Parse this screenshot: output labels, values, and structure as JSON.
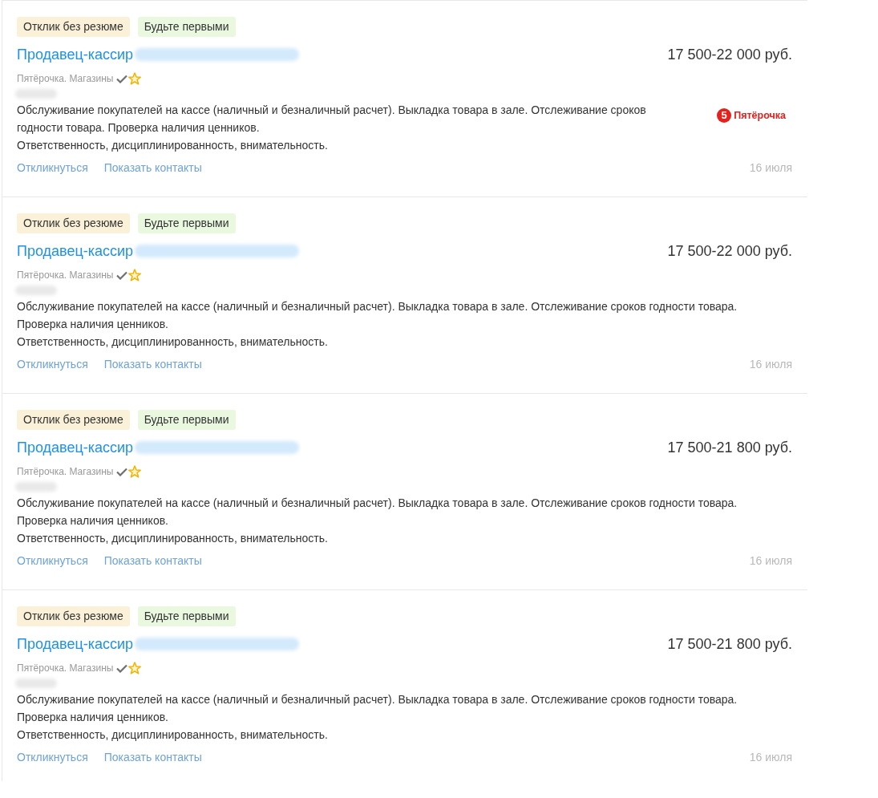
{
  "vacancies": [
    {
      "tags": [
        {
          "label": "Отклик без резюме",
          "color": "#fbf1d8"
        },
        {
          "label": "Будьте первыми",
          "color": "#eaf8e0"
        }
      ],
      "title": "Продавец-кассир",
      "salary": "17 500-22 000 руб.",
      "company": {
        "name": "Пятёрочка. Магазины",
        "verified": true,
        "starred": true
      },
      "logo": {
        "mark": "5",
        "text": "Пятёрочка"
      },
      "description": [
        "Обслуживание покупателей на кассе (наличный и безналичный расчет). Выкладка товара в зале. Отслеживание сроков годности товара. Проверка наличия ценников.",
        "Ответственность, дисциплинированность, внимательность."
      ],
      "actions": [
        "Откликнуться",
        "Показать контакты"
      ],
      "date": "16 июля"
    },
    {
      "tags": [
        {
          "label": "Отклик без резюме",
          "color": "#fbf1d8"
        },
        {
          "label": "Будьте первыми",
          "color": "#eaf8e0"
        }
      ],
      "title": "Продавец-кассир",
      "salary": "17 500-22 000 руб.",
      "company": {
        "name": "Пятёрочка. Магазины",
        "verified": true,
        "starred": true
      },
      "description": [
        "Обслуживание покупателей на кассе (наличный и безналичный расчет). Выкладка товара в зале. Отслеживание сроков годности товара. Проверка наличия ценников.",
        "Ответственность, дисциплинированность, внимательность."
      ],
      "actions": [
        "Откликнуться",
        "Показать контакты"
      ],
      "date": "16 июля"
    },
    {
      "tags": [
        {
          "label": "Отклик без резюме",
          "color": "#fbf1d8"
        },
        {
          "label": "Будьте первыми",
          "color": "#eaf8e0"
        }
      ],
      "title": "Продавец-кассир",
      "salary": "17 500-21 800 руб.",
      "company": {
        "name": "Пятёрочка. Магазины",
        "verified": true,
        "starred": true
      },
      "description": [
        "Обслуживание покупателей на кассе (наличный и безналичный расчет). Выкладка товара в зале. Отслеживание сроков годности товара. Проверка наличия ценников.",
        "Ответственность, дисциплинированность, внимательность."
      ],
      "actions": [
        "Откликнуться",
        "Показать контакты"
      ],
      "date": "16 июля"
    },
    {
      "tags": [
        {
          "label": "Отклик без резюме",
          "color": "#fbf1d8"
        },
        {
          "label": "Будьте первыми",
          "color": "#eaf8e0"
        }
      ],
      "title": "Продавец-кассир",
      "salary": "17 500-21 800 руб.",
      "company": {
        "name": "Пятёрочка. Магазины",
        "verified": true,
        "starred": true
      },
      "description": [
        "Обслуживание покупателей на кассе (наличный и безналичный расчет). Выкладка товара в зале. Отслеживание сроков годности товара. Проверка наличия ценников.",
        "Ответственность, дисциплинированность, внимательность."
      ],
      "actions": [
        "Откликнуться",
        "Показать контакты"
      ],
      "date": "16 июля"
    }
  ]
}
